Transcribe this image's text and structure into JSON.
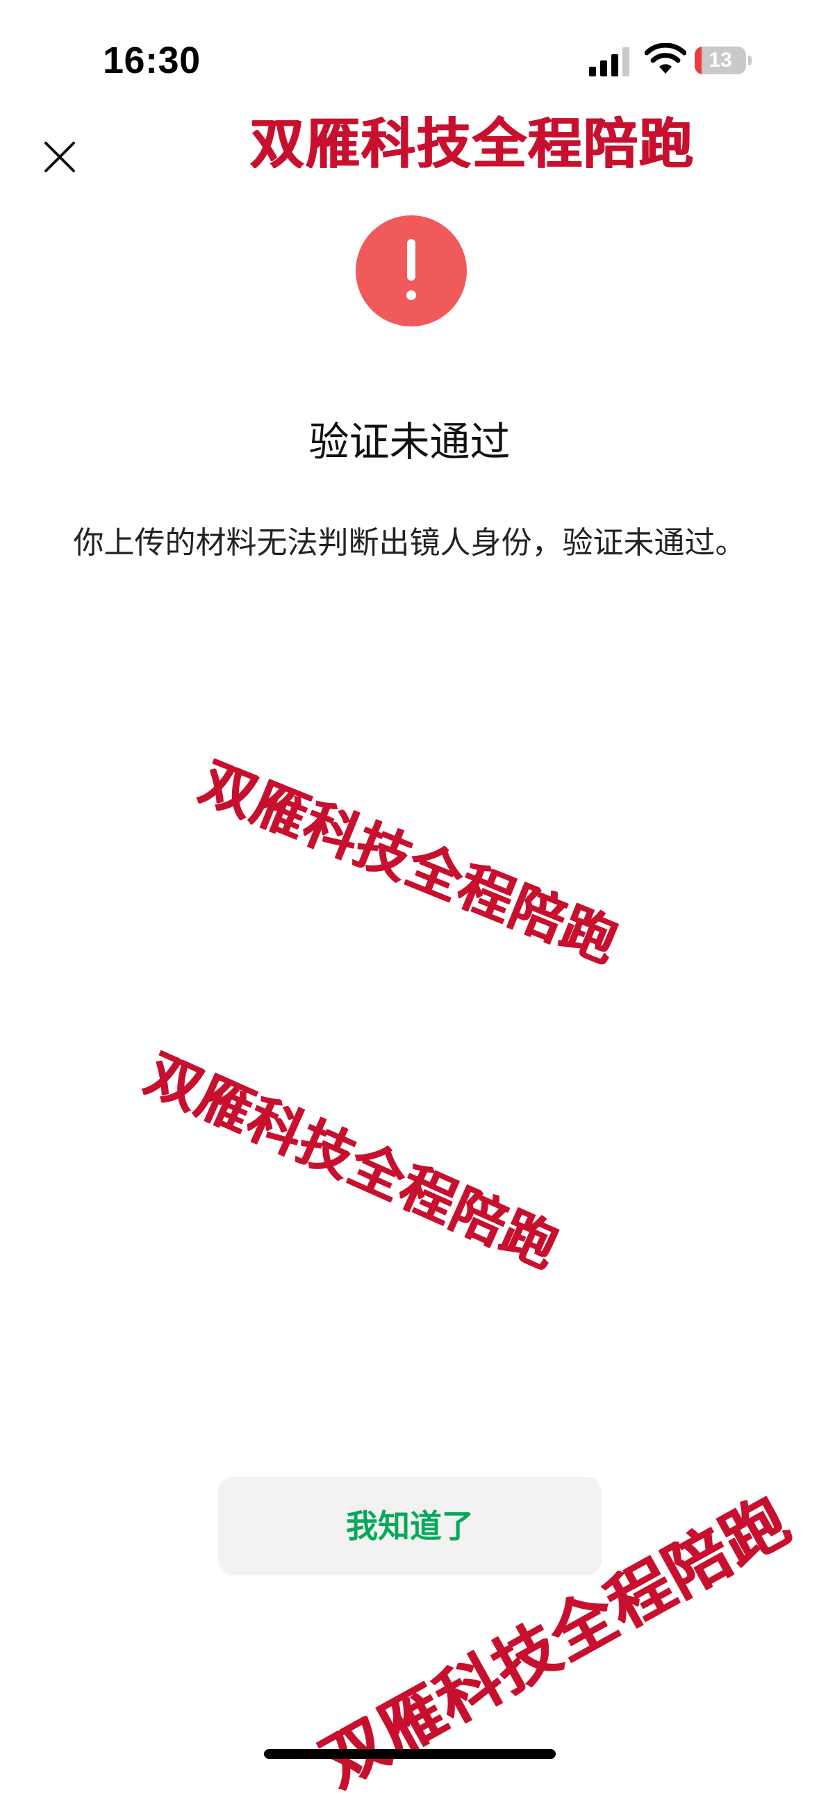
{
  "status_bar": {
    "time": "16:30",
    "battery_level": "13",
    "battery_fraction": 0.13,
    "battery_color": "#ef3b3b"
  },
  "watermark": {
    "text": "双雁科技全程陪跑",
    "color": "#c8102e"
  },
  "result": {
    "icon": "exclamation-circle-icon",
    "icon_color": "#f15a5a",
    "title": "验证未通过",
    "message": "你上传的材料无法判断出镜人身份，验证未通过。"
  },
  "actions": {
    "confirm_label": "我知道了",
    "confirm_color": "#07a85a"
  }
}
